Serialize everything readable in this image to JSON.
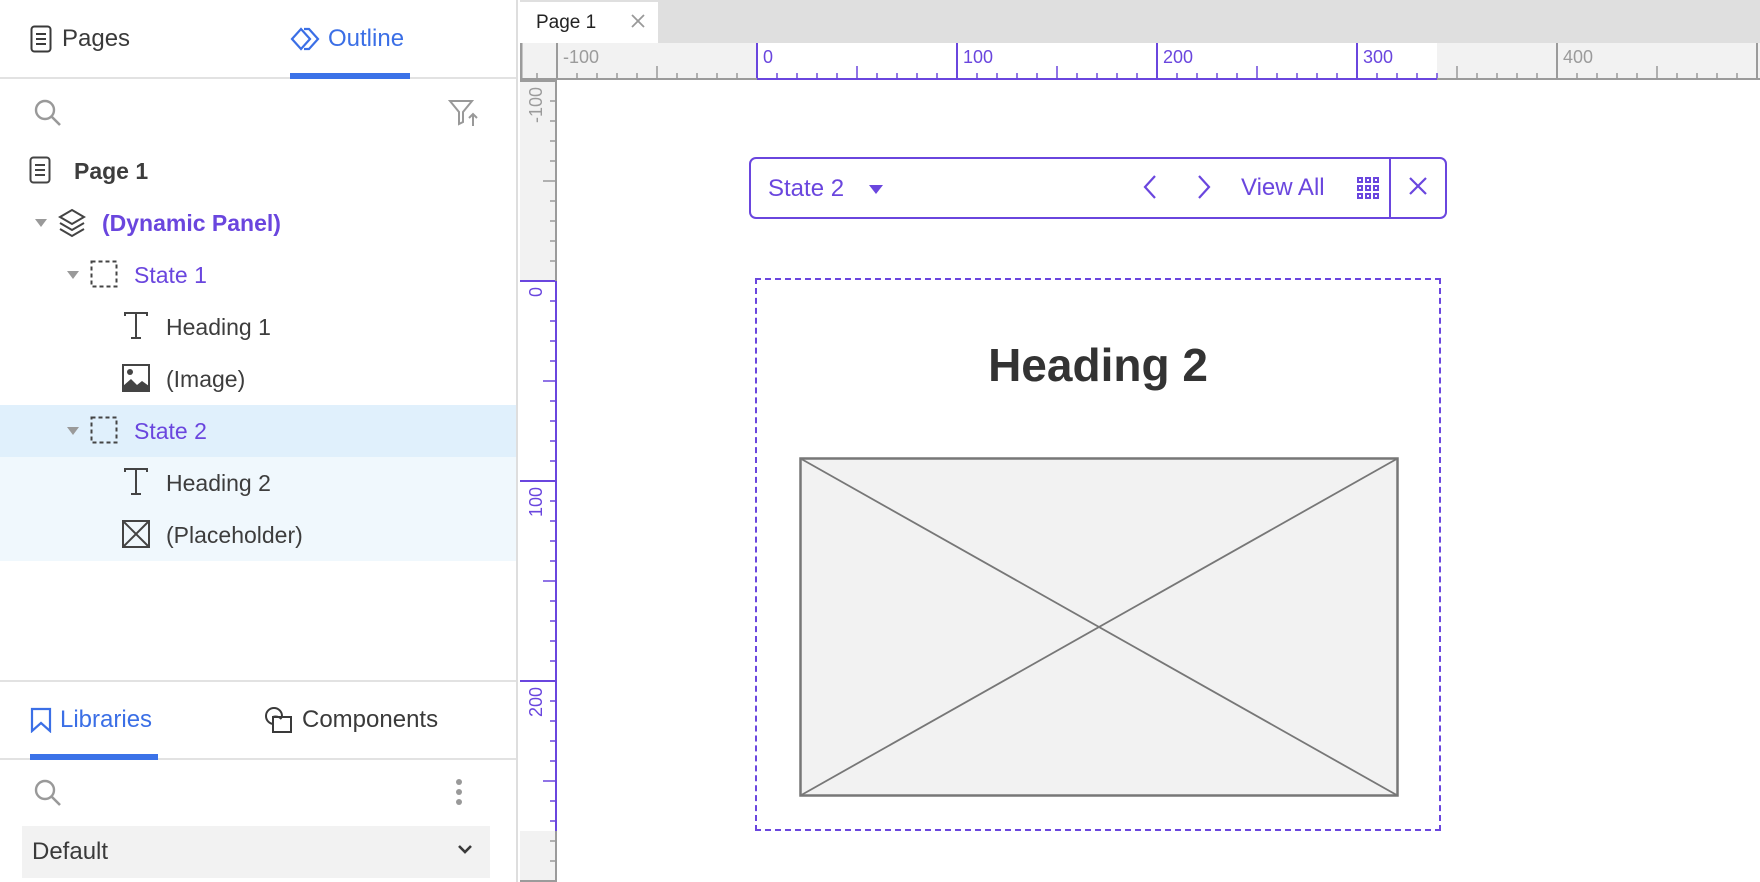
{
  "sidebar": {
    "tabs": [
      {
        "label": "Pages",
        "icon": "page-icon",
        "active": false
      },
      {
        "label": "Outline",
        "icon": "outline-icon",
        "active": true
      }
    ],
    "tree": [
      {
        "label": "Page 1",
        "icon": "page-icon",
        "level": 0,
        "bold": true,
        "purple": false
      },
      {
        "label": "(Dynamic Panel)",
        "icon": "layers-icon",
        "level": 1,
        "bold": true,
        "purple": true,
        "expanded": true
      },
      {
        "label": "State 1",
        "icon": "state-icon",
        "level": 2,
        "purple": true,
        "expanded": true
      },
      {
        "label": "Heading 1",
        "icon": "text-icon",
        "level": 3
      },
      {
        "label": "(Image)",
        "icon": "image-icon",
        "level": 3
      },
      {
        "label": "State 2",
        "icon": "state-icon",
        "level": 2,
        "purple": true,
        "expanded": true,
        "selected": true
      },
      {
        "label": "Heading 2",
        "icon": "text-icon",
        "level": 3
      },
      {
        "label": "(Placeholder)",
        "icon": "placeholder-icon",
        "level": 3
      }
    ],
    "bottom_tabs": [
      {
        "label": "Libraries",
        "icon": "bookmark-icon",
        "active": true
      },
      {
        "label": "Components",
        "icon": "components-icon",
        "active": false
      }
    ],
    "library_select": {
      "value": "Default"
    }
  },
  "document_tabs": [
    {
      "label": "Page 1"
    }
  ],
  "rulers": {
    "horizontal_labels": [
      "-100",
      "0",
      "100",
      "200",
      "300",
      "400"
    ],
    "vertical_labels": [
      "-100",
      "0",
      "100",
      "200"
    ]
  },
  "state_toolbar": {
    "state_name": "State 2",
    "view_all_label": "View All"
  },
  "canvas": {
    "heading_text": "Heading 2"
  },
  "colors": {
    "accent_blue": "#3b72e8",
    "panel_purple": "#6a46de",
    "selected_row": "#e0f0fc"
  }
}
